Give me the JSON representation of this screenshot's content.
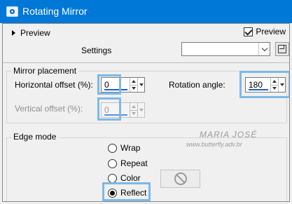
{
  "window": {
    "title": "Rotating Mirror",
    "icon": "rotating-mirror-app-icon"
  },
  "top": {
    "preview_toggle_label": "Preview",
    "preview_checkbox_label": "Preview",
    "preview_checked": true
  },
  "settings": {
    "label": "Settings",
    "value": ""
  },
  "mirror_placement": {
    "title": "Mirror placement",
    "horizontal_offset_label": "Horizontal offset (%):",
    "horizontal_offset_value": "0",
    "rotation_angle_label": "Rotation angle:",
    "rotation_angle_value": "180",
    "vertical_offset_label": "Vertical offset (%):",
    "vertical_offset_value": "0",
    "vertical_offset_enabled": false
  },
  "edge_mode": {
    "title": "Edge mode",
    "options": [
      "Wrap",
      "Repeat",
      "Color",
      "Reflect"
    ],
    "selected": "Reflect"
  },
  "watermark": {
    "line1": "MARIA JOSÉ",
    "line2": "www.butterfly.adv.br"
  },
  "colors": {
    "titlebar": "#0078d7",
    "highlight": "#7db9e8",
    "spin_underline": "#1565c0"
  },
  "icons": [
    "rotating-mirror-app-icon",
    "expand-triangle-icon",
    "checkbox-icon",
    "chevron-down-icon",
    "save-icon",
    "spin-up-icon",
    "spin-down-icon",
    "no-color-icon",
    "radio-icon"
  ]
}
